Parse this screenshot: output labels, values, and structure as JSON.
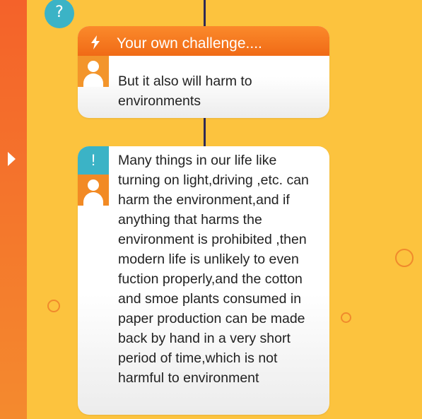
{
  "badges": {
    "question": "?",
    "exclaim": "!"
  },
  "card1": {
    "header_title": "Your own challenge....",
    "text": "But it also will harm to environments"
  },
  "card2": {
    "text": "Many things in our life like turning on light,driving ,etc. can harm the environment,and if anything that harms the environment is prohibited ,then modern life is unlikely to even fuction properly,and the cotton and smoe plants consumed in paper production can be made back by hand in a very short period of time,which is not harmful to environment"
  },
  "colors": {
    "background": "#fcc33e",
    "sidebar": "#f4622a",
    "header": "#f57a1f",
    "teal": "#3bb3c6",
    "avatar": "#f3952b",
    "timeline": "#2e2a55"
  },
  "icons": [
    "sidebar-arrow-icon",
    "question-icon",
    "bolt-icon",
    "user-avatar-icon",
    "exclamation-icon"
  ]
}
